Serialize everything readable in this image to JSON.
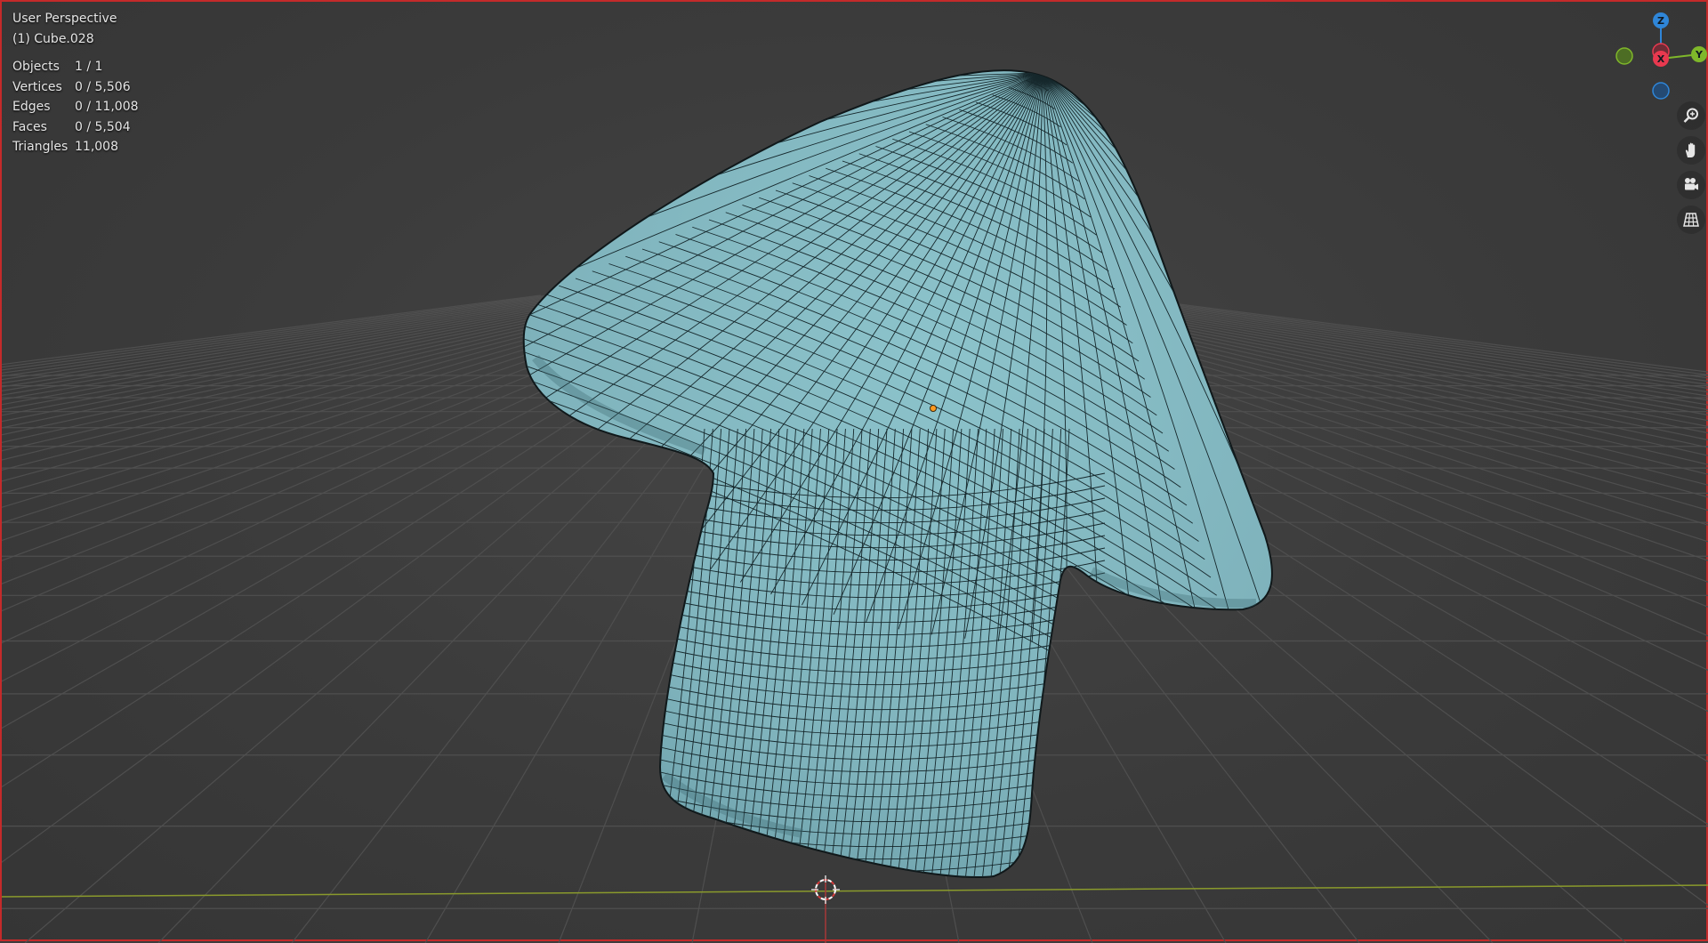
{
  "viewport": {
    "view_name": "User Perspective",
    "active_object": "(1) Cube.028"
  },
  "stats": [
    {
      "label": "Objects",
      "value": "1 / 1"
    },
    {
      "label": "Vertices",
      "value": "0 / 5,506"
    },
    {
      "label": "Edges",
      "value": "0 / 11,008"
    },
    {
      "label": "Faces",
      "value": "0 / 5,504"
    },
    {
      "label": "Triangles",
      "value": "11,008"
    }
  ],
  "gizmo": {
    "x_label": "X",
    "y_label": "Y",
    "z_label": "Z",
    "x_color": "#e8394f",
    "y_color": "#7fb72a",
    "z_color": "#2f86d8"
  },
  "navigation": [
    {
      "name": "zoom-icon"
    },
    {
      "name": "pan-hand-icon"
    },
    {
      "name": "camera-icon"
    },
    {
      "name": "grid-ortho-icon"
    }
  ],
  "mesh": {
    "fill_color": "#7fb3bc",
    "wire_color": "#16282c"
  }
}
